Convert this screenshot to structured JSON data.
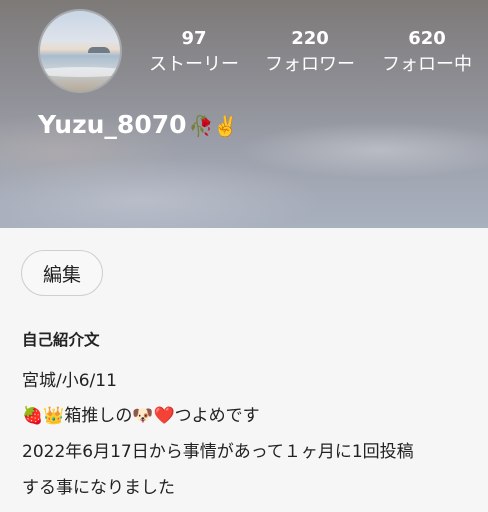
{
  "profile": {
    "username": "Yuzu_8070",
    "username_emoji": "🥀✌️",
    "avatar_icon": "beach-sunset-photo"
  },
  "stats": {
    "stories": {
      "count": "97",
      "label": "ストーリー"
    },
    "followers": {
      "count": "220",
      "label": "フォロワー"
    },
    "following": {
      "count": "620",
      "label": "フォロー中"
    }
  },
  "actions": {
    "edit_label": "編集"
  },
  "bio": {
    "heading": "自己紹介文",
    "lines": [
      "宮城/小6/11",
      "🍓👑箱推しの🐶❤️つよめです",
      "2022年6月17日から事情があって１ヶ月に1回投稿",
      "する事になりました"
    ]
  },
  "colors": {
    "header_tint": "#8f8f96",
    "page_background": "#f6f6f6",
    "text": "#222222"
  }
}
